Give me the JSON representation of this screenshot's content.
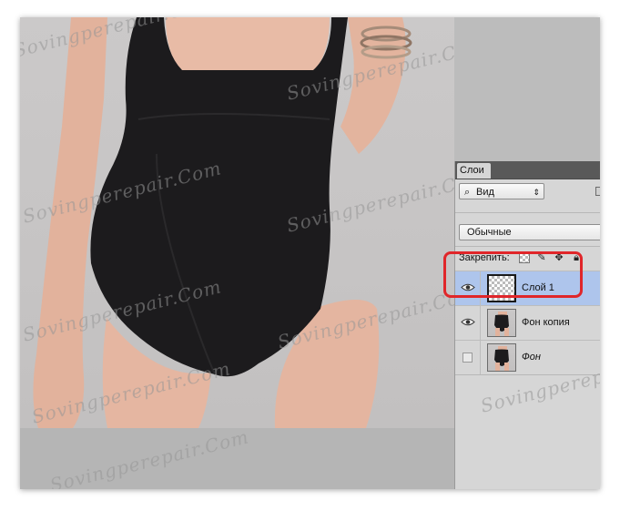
{
  "canvas": {
    "watermark_text": "Sovingperepair.Com",
    "skin_color": "#e7b8a2",
    "swimsuit_color": "#1c1b1d",
    "background_color": "#c8c6c6"
  },
  "layers_panel": {
    "tab_label": "Слои",
    "filter": {
      "icon": "search-icon",
      "label": "Вид",
      "arrow": "⇕"
    },
    "blend_mode": "Обычные",
    "lock_label": "Закрепить:",
    "layers": [
      {
        "name": "Слой 1",
        "visible": true,
        "selected": true,
        "thumb": "transparent",
        "italic": false
      },
      {
        "name": "Фон копия",
        "visible": true,
        "selected": false,
        "thumb": "photo",
        "italic": false
      },
      {
        "name": "Фон",
        "visible": false,
        "selected": false,
        "thumb": "photo",
        "italic": true
      }
    ]
  },
  "annotation": {
    "color": "#e0262a"
  }
}
